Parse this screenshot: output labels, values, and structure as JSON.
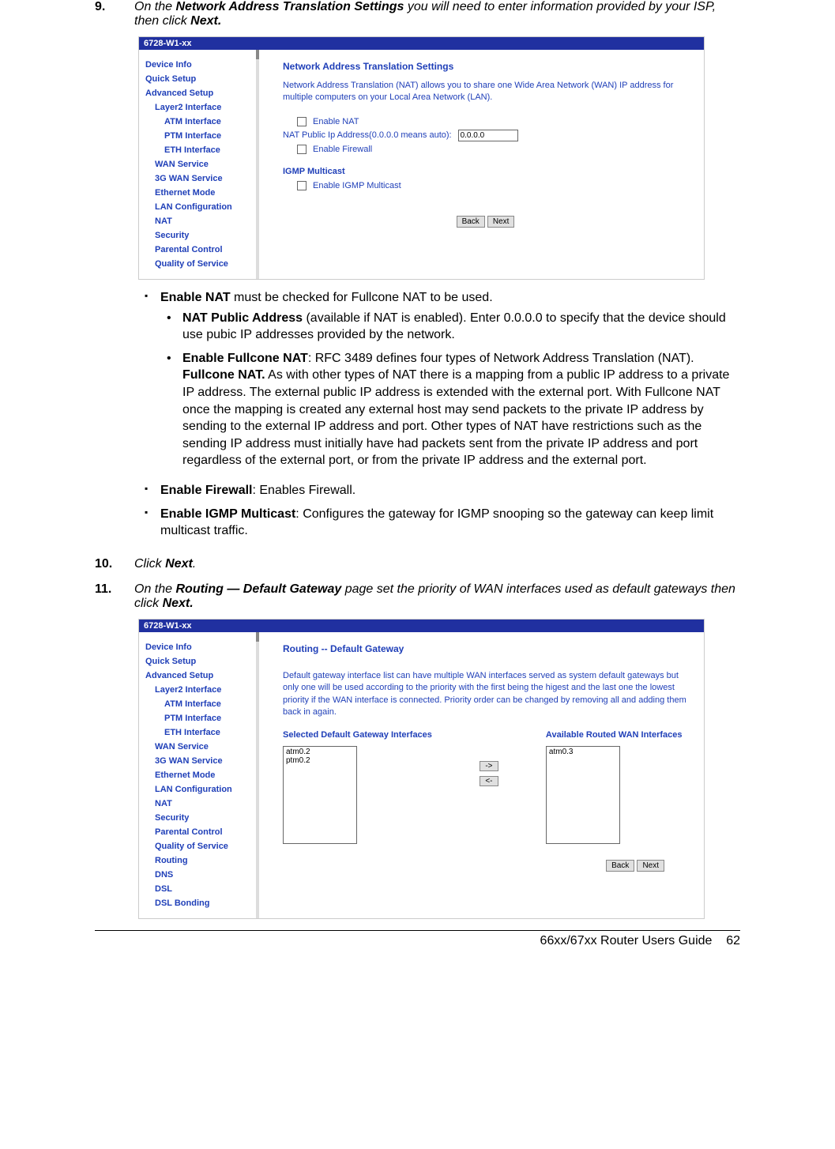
{
  "steps": {
    "s9": {
      "num": "9.",
      "pre": "On the ",
      "bold1": "Network Address Translation Settings",
      "mid": " you will need to enter information provided by your ISP, then click ",
      "bold2": "Next."
    },
    "s10": {
      "num": "10.",
      "pre": "Click ",
      "bold1": "Next",
      "post": "."
    },
    "s11": {
      "num": "11.",
      "pre": "On the ",
      "bold1": "Routing — Default Gateway",
      "mid": " page set the priority of WAN interfaces used as default gateways then click ",
      "bold2": "Next."
    }
  },
  "shot1": {
    "title": "6728-W1-xx",
    "nav": [
      "Device Info",
      "Quick Setup",
      "Advanced Setup",
      "Layer2 Interface",
      "ATM Interface",
      "PTM Interface",
      "ETH Interface",
      "WAN Service",
      "3G WAN Service",
      "Ethernet Mode",
      "LAN Configuration",
      "NAT",
      "Security",
      "Parental Control",
      "Quality of Service"
    ],
    "heading": "Network Address Translation Settings",
    "desc": "Network Address Translation (NAT) allows you to share one Wide Area Network (WAN) IP address for multiple computers on your Local Area Network (LAN).",
    "enable_nat": "Enable NAT",
    "nat_ip_label": "NAT Public Ip Address(0.0.0.0 means auto):",
    "nat_ip_value": "0.0.0.0",
    "enable_fw": "Enable Firewall",
    "igmp_head": "IGMP Multicast",
    "enable_igmp": "Enable IGMP Multicast",
    "back": "Back",
    "next": "Next"
  },
  "bullets": {
    "b1_bold": "Enable NAT",
    "b1_rest": " must be checked for Fullcone NAT to be used.",
    "b1a_bold": "NAT Public Address",
    "b1a_rest": " (available if NAT is enabled). Enter 0.0.0.0 to specify that the device should use pubic IP addresses provided by the network.",
    "b1b_bold": "Enable Fullcone NAT",
    "b1b_rest1": ": RFC 3489 defines four types of Network Address Translation (NAT).",
    "b1b_bold2": "Fullcone NAT.",
    "b1b_rest2": " As with other types of NAT there is a mapping from a public IP address to a private IP address. The external public IP address is extended with the external port. With Fullcone NAT once the mapping is created any external host may send packets to the private IP address by sending to the external IP address and port. Other types of NAT have restrictions such as the sending IP address must initially have had packets sent from the private IP address and port regardless of the external port, or from the private IP address and the external port.",
    "b2_bold": "Enable Firewall",
    "b2_rest": ": Enables Firewall.",
    "b3_bold": "Enable IGMP Multicast",
    "b3_rest": ": Configures the gateway for IGMP snooping so the gateway can keep limit multicast traffic."
  },
  "shot2": {
    "title": "6728-W1-xx",
    "nav": [
      "Device Info",
      "Quick Setup",
      "Advanced Setup",
      "Layer2 Interface",
      "ATM Interface",
      "PTM Interface",
      "ETH Interface",
      "WAN Service",
      "3G WAN Service",
      "Ethernet Mode",
      "LAN Configuration",
      "NAT",
      "Security",
      "Parental Control",
      "Quality of Service",
      "Routing",
      "DNS",
      "DSL",
      "DSL Bonding"
    ],
    "heading": "Routing -- Default Gateway",
    "desc": "Default gateway interface list can have multiple WAN interfaces served as system default gateways but only one will be used according to the priority with the first being the higest and the last one the lowest priority if the WAN interface is connected. Priority order can be changed by removing all and adding them back in again.",
    "left_label": "Selected Default Gateway Interfaces",
    "right_label": "Available Routed WAN Interfaces",
    "left_items": [
      "atm0.2",
      "ptm0.2"
    ],
    "right_items": [
      "atm0.3"
    ],
    "arrow_r": "->",
    "arrow_l": "<-",
    "back": "Back",
    "next": "Next"
  },
  "footer": {
    "title": "66xx/67xx Router Users Guide",
    "page": "62"
  }
}
